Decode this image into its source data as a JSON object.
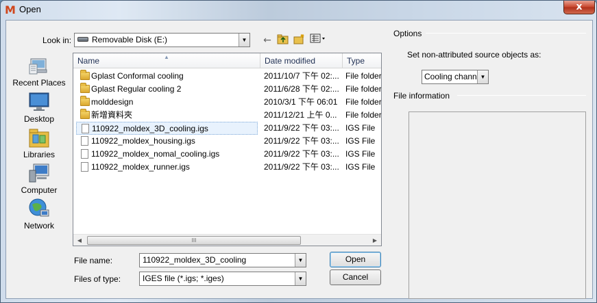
{
  "window": {
    "title": "Open",
    "close_label": "x"
  },
  "look_in": {
    "label": "Look in:",
    "value": "Removable Disk (E:)"
  },
  "toolbar": {
    "back_icon": "back-arrow-icon",
    "up_icon": "up-folder-icon",
    "new_folder_icon": "new-folder-icon",
    "views_icon": "views-menu-icon"
  },
  "places": [
    {
      "label": "Recent Places",
      "icon": "recent-places-icon"
    },
    {
      "label": "Desktop",
      "icon": "desktop-icon"
    },
    {
      "label": "Libraries",
      "icon": "libraries-icon"
    },
    {
      "label": "Computer",
      "icon": "computer-icon"
    },
    {
      "label": "Network",
      "icon": "network-icon"
    }
  ],
  "list": {
    "columns": {
      "name": "Name",
      "date": "Date modified",
      "type": "Type"
    },
    "rows": [
      {
        "name": "Gplast Conformal cooling",
        "date": "2011/10/7 下午 02:...",
        "type": "File folder",
        "kind": "folder"
      },
      {
        "name": "Gplast Regular cooling 2",
        "date": "2011/6/28 下午 02:...",
        "type": "File folder",
        "kind": "folder"
      },
      {
        "name": "molddesign",
        "date": "2010/3/1 下午 06:01",
        "type": "File folder",
        "kind": "folder"
      },
      {
        "name": "新增資料夾",
        "date": "2011/12/21 上午 0...",
        "type": "File folder",
        "kind": "folder"
      },
      {
        "name": "110922_moldex_3D_cooling.igs",
        "date": "2011/9/22 下午 03:...",
        "type": "IGS File",
        "kind": "file",
        "selected": true
      },
      {
        "name": "110922_moldex_housing.igs",
        "date": "2011/9/22 下午 03:...",
        "type": "IGS File",
        "kind": "file"
      },
      {
        "name": "110922_moldex_nomal_cooling.igs",
        "date": "2011/9/22 下午 03:...",
        "type": "IGS File",
        "kind": "file"
      },
      {
        "name": "110922_moldex_runner.igs",
        "date": "2011/9/22 下午 03:...",
        "type": "IGS File",
        "kind": "file"
      }
    ],
    "scroll_grip": "III"
  },
  "file_name": {
    "label": "File name:",
    "value": "110922_moldex_3D_cooling"
  },
  "file_type": {
    "label": "Files of type:",
    "value": "IGES file (*.igs; *.iges)"
  },
  "buttons": {
    "open": "Open",
    "cancel": "Cancel"
  },
  "options": {
    "title": "Options",
    "source_label": "Set non-attributed source objects as:",
    "source_value": "Cooling channel",
    "file_info_title": "File information"
  }
}
